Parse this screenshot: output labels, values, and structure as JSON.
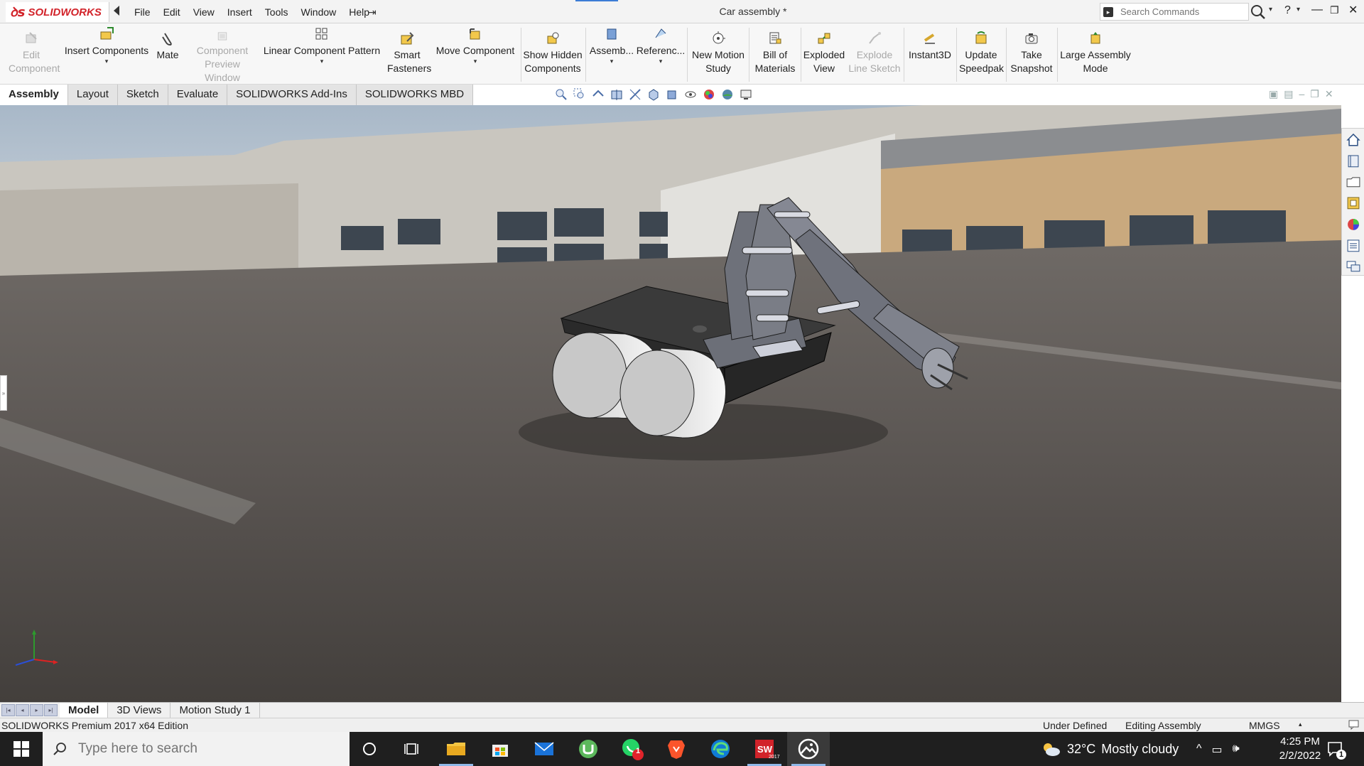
{
  "app": {
    "brand": "SOLIDWORKS",
    "menu": [
      "File",
      "Edit",
      "View",
      "Insert",
      "Tools",
      "Window",
      "Help"
    ],
    "document_title": "Car assembly *",
    "search": {
      "placeholder": "Search Commands"
    },
    "help_label": "?"
  },
  "ribbon": {
    "commands": [
      {
        "id": "edit-component",
        "label": "Edit Component",
        "enabled": false
      },
      {
        "id": "insert-components",
        "label": "Insert Components",
        "enabled": true
      },
      {
        "id": "mate",
        "label": "Mate",
        "enabled": true
      },
      {
        "id": "component-preview-window",
        "label": "Component Preview Window",
        "enabled": false
      },
      {
        "id": "linear-component-pattern",
        "label": "Linear Component Pattern",
        "enabled": true
      },
      {
        "id": "smart-fasteners",
        "label": "Smart Fasteners",
        "enabled": true
      },
      {
        "id": "move-component",
        "label": "Move Component",
        "enabled": true
      },
      {
        "id": "show-hidden-components",
        "label": "Show Hidden Components",
        "enabled": true
      },
      {
        "id": "assembly-features",
        "label": "Assemb...",
        "enabled": true
      },
      {
        "id": "reference-geometry",
        "label": "Referenc...",
        "enabled": true
      },
      {
        "id": "new-motion-study",
        "label": "New Motion Study",
        "enabled": true
      },
      {
        "id": "bill-of-materials",
        "label": "Bill of Materials",
        "enabled": true
      },
      {
        "id": "exploded-view",
        "label": "Exploded View",
        "enabled": true
      },
      {
        "id": "explode-line-sketch",
        "label": "Explode Line Sketch",
        "enabled": false
      },
      {
        "id": "instant3d",
        "label": "Instant3D",
        "enabled": true
      },
      {
        "id": "update-speedpak",
        "label": "Update Speedpak",
        "enabled": true
      },
      {
        "id": "take-snapshot",
        "label": "Take Snapshot",
        "enabled": true
      },
      {
        "id": "large-assembly-mode",
        "label": "Large Assembly Mode",
        "enabled": true
      }
    ],
    "tabs": [
      "Assembly",
      "Layout",
      "Sketch",
      "Evaluate",
      "SOLIDWORKS Add-Ins",
      "SOLIDWORKS MBD"
    ],
    "active_tab": "Assembly"
  },
  "bottom_tabs": {
    "items": [
      "Model",
      "3D Views",
      "Motion Study 1"
    ],
    "active": "Model"
  },
  "status": {
    "edition": "SOLIDWORKS Premium 2017 x64 Edition",
    "definition": "Under Defined",
    "mode": "Editing Assembly",
    "units": "MMGS"
  },
  "taskbar": {
    "search_placeholder": "Type here to search",
    "weather_temp": "32°C",
    "weather_desc": "Mostly cloudy",
    "time": "4:25 PM",
    "date": "2/2/2022",
    "whatsapp_badge": "1",
    "notification_count": "1",
    "solidworks_year": "2017"
  },
  "colors": {
    "brand_red": "#d2232a",
    "ribbon_bg": "#f7f7f7",
    "taskbar_bg": "#1f1f1f",
    "selection_blue": "#3c7cd6"
  }
}
